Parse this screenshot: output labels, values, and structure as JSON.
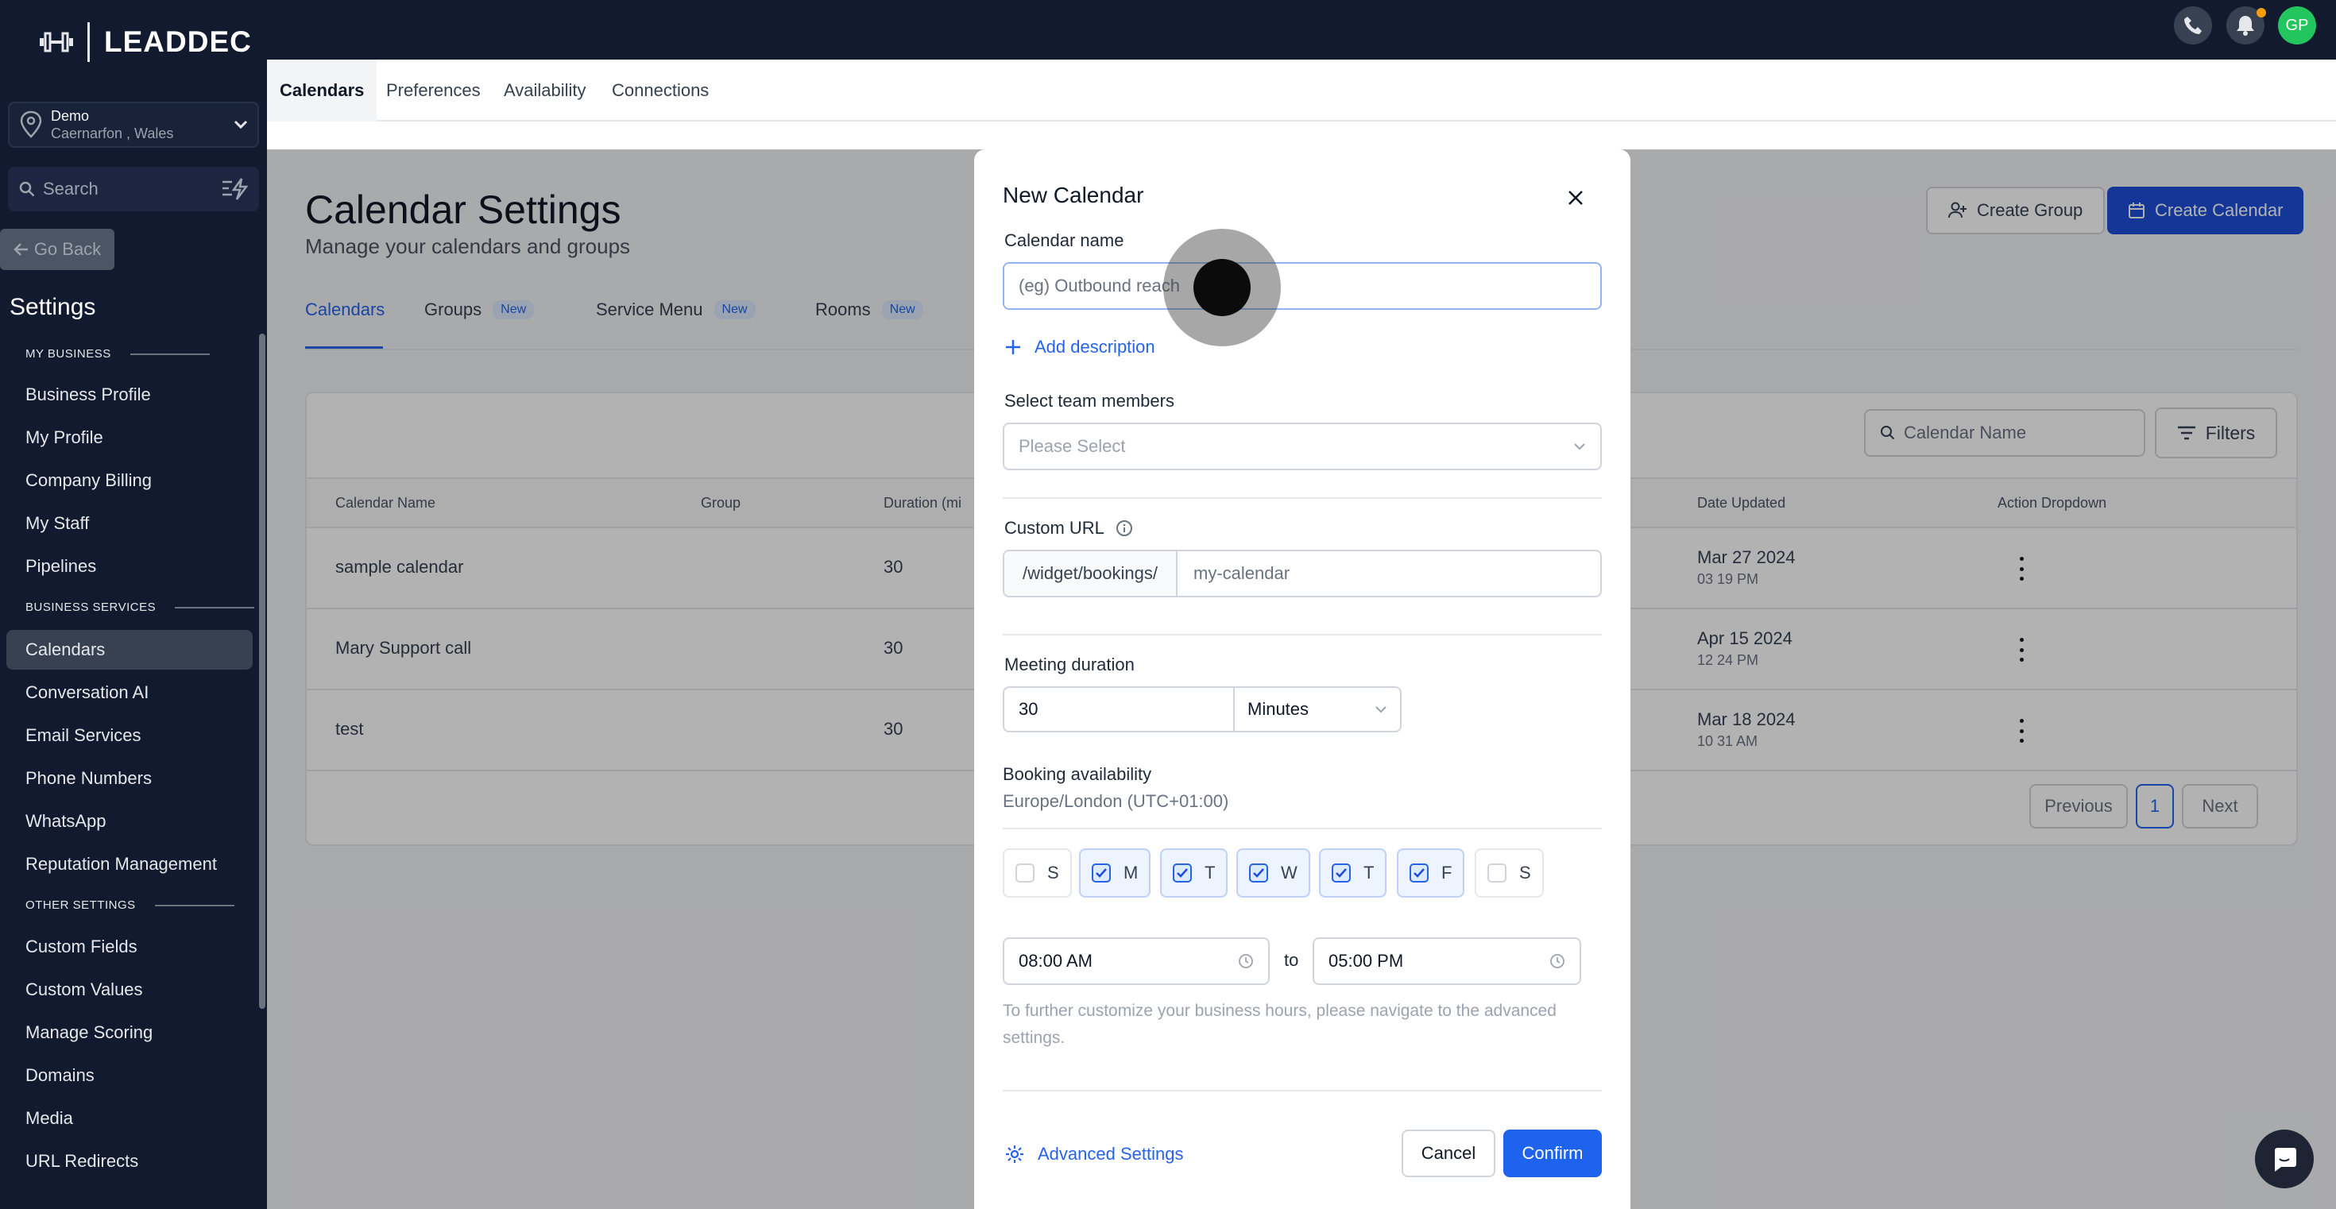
{
  "brand": {
    "name": "LEADDEC"
  },
  "location": {
    "name": "Demo",
    "sub": "Caernarfon , Wales"
  },
  "sidebar": {
    "search_placeholder": "Search",
    "go_back": "Go Back",
    "settings_title": "Settings",
    "sections": [
      {
        "label": "MY BUSINESS"
      },
      {
        "label": "BUSINESS SERVICES"
      },
      {
        "label": "OTHER SETTINGS"
      }
    ],
    "items": [
      {
        "label": "Business Profile"
      },
      {
        "label": "My Profile"
      },
      {
        "label": "Company Billing"
      },
      {
        "label": "My Staff"
      },
      {
        "label": "Pipelines"
      },
      {
        "label": "Calendars"
      },
      {
        "label": "Conversation AI"
      },
      {
        "label": "Email Services"
      },
      {
        "label": "Phone Numbers"
      },
      {
        "label": "WhatsApp"
      },
      {
        "label": "Reputation Management"
      },
      {
        "label": "Custom Fields"
      },
      {
        "label": "Custom Values"
      },
      {
        "label": "Manage Scoring"
      },
      {
        "label": "Domains"
      },
      {
        "label": "Media"
      },
      {
        "label": "URL Redirects"
      }
    ]
  },
  "topbar": {
    "avatar_initials": "GP",
    "accent": "#22c55e"
  },
  "tabs": [
    {
      "label": "Calendars"
    },
    {
      "label": "Preferences"
    },
    {
      "label": "Availability"
    },
    {
      "label": "Connections"
    }
  ],
  "page": {
    "title": "Calendar Settings",
    "subtitle": "Manage your calendars and groups",
    "create_group": "Create Group",
    "create_calendar": "Create Calendar",
    "subtabs": [
      {
        "label": "Calendars",
        "badge": ""
      },
      {
        "label": "Groups",
        "badge": "New"
      },
      {
        "label": "Service Menu",
        "badge": "New"
      },
      {
        "label": "Rooms",
        "badge": "New"
      }
    ]
  },
  "table": {
    "search_placeholder": "Calendar Name",
    "filters": "Filters",
    "headers": [
      "Calendar Name",
      "Group",
      "Duration (mi",
      "Date Updated",
      "Action Dropdown"
    ],
    "rows": [
      {
        "name": "sample calendar",
        "duration": "30",
        "date": "Mar 27 2024",
        "time": "03 19 PM"
      },
      {
        "name": "Mary Support call",
        "duration": "30",
        "date": "Apr 15 2024",
        "time": "12 24 PM"
      },
      {
        "name": "test",
        "duration": "30",
        "date": "Mar 18 2024",
        "time": "10 31 AM"
      }
    ],
    "pager": {
      "previous": "Previous",
      "current": "1",
      "next": "Next"
    }
  },
  "modal": {
    "title": "New Calendar",
    "name_label": "Calendar name",
    "name_placeholder": "(eg) Outbound reach",
    "add_description": "Add description",
    "team_label": "Select team members",
    "team_placeholder": "Please Select",
    "url_label": "Custom URL",
    "url_prefix": "/widget/bookings/",
    "url_placeholder": "my-calendar",
    "duration_label": "Meeting duration",
    "duration_value": "30",
    "duration_unit": "Minutes",
    "availability_label": "Booking availability",
    "timezone": "Europe/London (UTC+01:00)",
    "days": [
      {
        "label": "S",
        "checked": false
      },
      {
        "label": "M",
        "checked": true
      },
      {
        "label": "T",
        "checked": true
      },
      {
        "label": "W",
        "checked": true
      },
      {
        "label": "T",
        "checked": true
      },
      {
        "label": "F",
        "checked": true
      },
      {
        "label": "S",
        "checked": false
      }
    ],
    "start_time": "08:00 AM",
    "to": "to",
    "end_time": "05:00 PM",
    "helper": "To further customize your business hours, please navigate to the advanced settings.",
    "advanced": "Advanced Settings",
    "cancel": "Cancel",
    "confirm": "Confirm"
  }
}
